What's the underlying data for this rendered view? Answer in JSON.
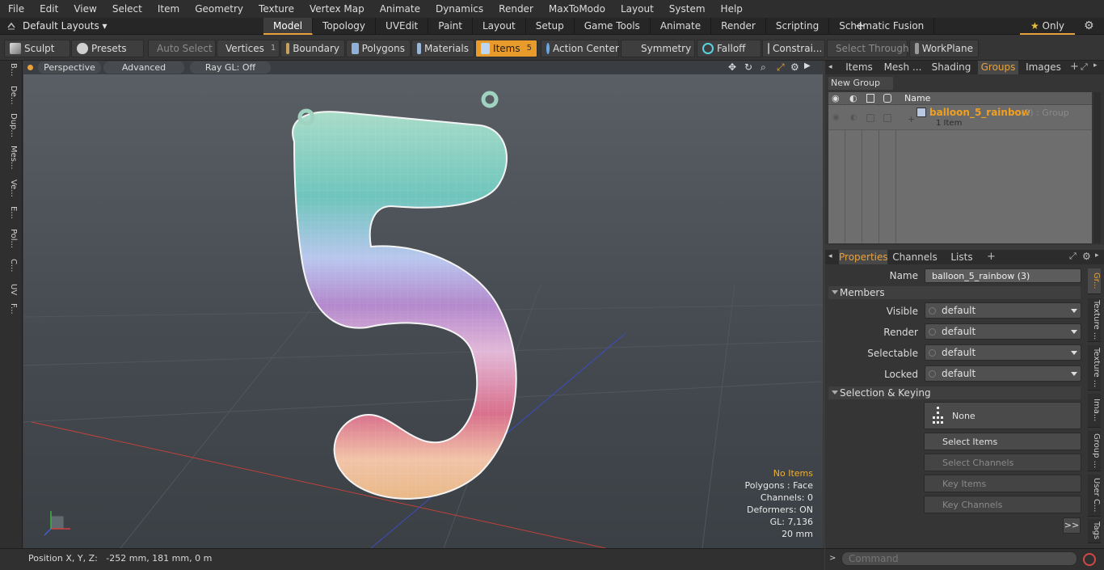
{
  "menu": [
    "File",
    "Edit",
    "View",
    "Select",
    "Item",
    "Geometry",
    "Texture",
    "Vertex Map",
    "Animate",
    "Dynamics",
    "Render",
    "MaxToModo",
    "Layout",
    "System",
    "Help"
  ],
  "layout_selector": "Default Layouts",
  "mode_tabs": [
    {
      "label": "Model",
      "active": true
    },
    {
      "label": "Topology"
    },
    {
      "label": "UVEdit"
    },
    {
      "label": "Paint"
    },
    {
      "label": "Layout"
    },
    {
      "label": "Setup"
    },
    {
      "label": "Game Tools"
    },
    {
      "label": "Animate"
    },
    {
      "label": "Render"
    },
    {
      "label": "Scripting"
    },
    {
      "label": "Schematic Fusion"
    }
  ],
  "only_button": "Only",
  "toolbar": {
    "sculpt": "Sculpt",
    "presets": "Presets",
    "auto_select": "Auto Select",
    "vertices": "Vertices",
    "vertices_count": "1",
    "boundary": "Boundary",
    "polygons": "Polygons",
    "materials": "Materials",
    "items": "Items",
    "items_count": "5",
    "action_center": "Action Center",
    "symmetry": "Symmetry",
    "falloff": "Falloff",
    "constraints": "Constrai...",
    "select_through": "Select Through",
    "workplane": "WorkPlane"
  },
  "left_tabs": [
    "B...",
    "De...",
    "Dup...",
    "Mes...",
    "Ve...",
    "E...",
    "Pol...",
    "C...",
    "UV",
    "F..."
  ],
  "viewport": {
    "view": "Perspective",
    "shading": "Advanced",
    "raygl": "Ray GL: Off",
    "info": {
      "no_items": "No Items",
      "polygons": "Polygons : Face",
      "channels": "Channels: 0",
      "deformers": "Deformers: ON",
      "gl": "GL: 7,136",
      "scale": "20 mm"
    }
  },
  "groups_panel": {
    "tabs": [
      {
        "label": "Items"
      },
      {
        "label": "Mesh ..."
      },
      {
        "label": "Shading"
      },
      {
        "label": "Groups",
        "active": true
      },
      {
        "label": "Images"
      }
    ],
    "new_group": "New Group",
    "col_name": "Name",
    "group": {
      "name": "balloon_5_rainbow",
      "suffix": "(3) : Group",
      "items": "1 Item"
    }
  },
  "properties": {
    "tabs": [
      {
        "label": "Properties",
        "active": true
      },
      {
        "label": "Channels"
      },
      {
        "label": "Lists"
      }
    ],
    "name_label": "Name",
    "name_value": "balloon_5_rainbow (3)",
    "members_section": "Members",
    "fields": [
      {
        "label": "Visible",
        "value": "default"
      },
      {
        "label": "Render",
        "value": "default"
      },
      {
        "label": "Selectable",
        "value": "default"
      },
      {
        "label": "Locked",
        "value": "default"
      }
    ],
    "selection_section": "Selection & Keying",
    "none_btn": "None",
    "select_items": "Select Items",
    "select_channels": "Select Channels",
    "key_items": "Key Items",
    "key_channels": "Key Channels",
    "more": ">>"
  },
  "side_tabs": [
    "Gr...",
    "Texture ...",
    "Texture ...",
    "Ima...",
    "Group ...",
    "User C...",
    "Tags"
  ],
  "status": {
    "position": "Position X, Y, Z:   -252 mm, 181 mm, 0 m"
  },
  "command": {
    "placeholder": "Command"
  },
  "colors": {
    "accent": "#e8a13a",
    "active_tool": "#e89a2a",
    "group_name": "#f0a020"
  }
}
